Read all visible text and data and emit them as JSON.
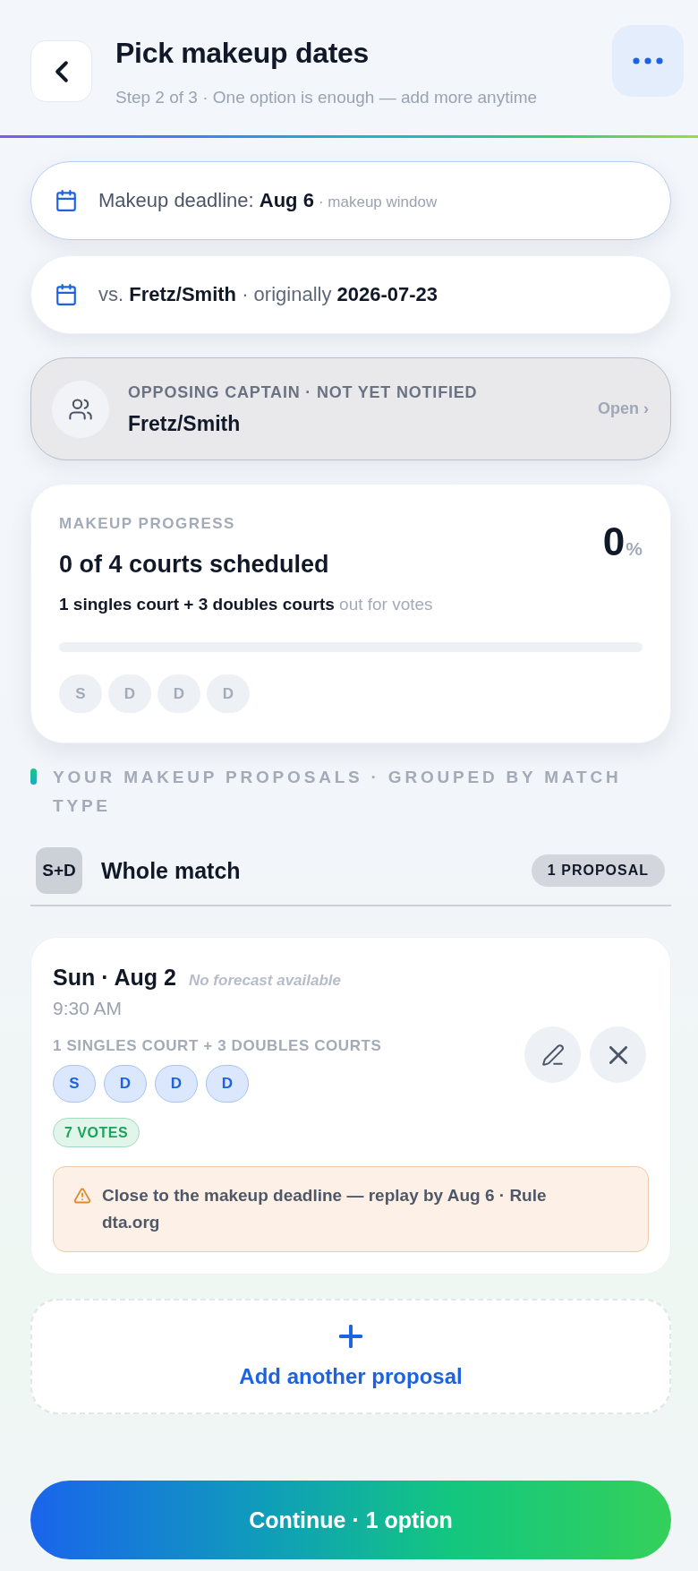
{
  "header": {
    "title": "Pick makeup dates",
    "subtitle": "Step 2 of 3 · One option is enough — add more anytime"
  },
  "deadline": {
    "text": "Makeup deadline: **Aug 6**",
    "note": "· makeup window"
  },
  "match": {
    "text": "vs. **Fretz/Smith** · originally **2026-07-23**"
  },
  "captain": {
    "label": "OPPOSING CAPTAIN · NOT YET NOTIFIED",
    "name": "Fretz/Smith",
    "action": "Open ›",
    "notified": false
  },
  "progress": {
    "label": "MAKEUP PROGRESS",
    "title": "0 of 4 courts scheduled",
    "summary": "**1 singles court + 3 doubles courts** out for votes",
    "percent": "0",
    "percent_sign": "%",
    "level": 0,
    "courts": [
      {
        "label": "S",
        "scheduled": false
      },
      {
        "label": "D",
        "scheduled": false
      },
      {
        "label": "D",
        "scheduled": false
      },
      {
        "label": "D",
        "scheduled": false
      }
    ]
  },
  "proposals_section": {
    "title": "YOUR MAKEUP PROPOSALS · GROUPED BY MATCH TYPE",
    "groups": [
      {
        "badge": "S+D",
        "title": "Whole match",
        "count": "1 PROPOSAL",
        "proposals": [
          {
            "date": "Sun · Aug 2",
            "forecast": "No forecast available",
            "time": "9:30 AM",
            "courts_label": "1 SINGLES COURT + 3 DOUBLES COURTS",
            "courts": [
              {
                "label": "S"
              },
              {
                "label": "D"
              },
              {
                "label": "D"
              },
              {
                "label": "D"
              }
            ],
            "votes": "7 VOTES",
            "warning": "Close to the makeup deadline — replay by Aug 6 · Rule dta.org"
          }
        ]
      }
    ]
  },
  "add_button": {
    "label": "Add another proposal"
  },
  "continue_button": {
    "label": "Continue · 1 option"
  }
}
